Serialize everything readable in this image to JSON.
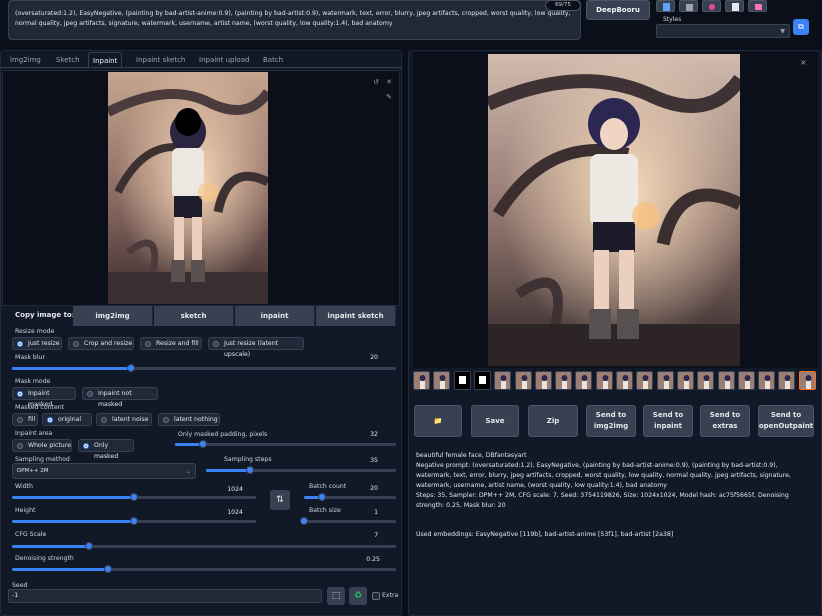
{
  "prompt_box": {
    "text": "(oversaturated:1.2), EasyNegative, (painting by bad-artist-anime:0.9), (painting by bad-artist:0.9), watermark, text, error, blurry, jpeg artifacts, cropped, worst quality, low quality, normal quality, jpeg artifacts, signature, watermark, username, artist name, (worst quality, low quality:1.4), bad anatomy",
    "token_counter": "69/75"
  },
  "toolbar": {
    "deepbooru_label": "DeepBooru",
    "styles_label": "Styles"
  },
  "tabs": [
    "img2img",
    "Sketch",
    "Inpaint",
    "Inpaint sketch",
    "Inpaint upload",
    "Batch"
  ],
  "copy_image": {
    "label": "Copy image to:",
    "targets": [
      "img2img",
      "sketch",
      "inpaint",
      "inpaint sketch"
    ]
  },
  "resize_mode": {
    "label": "Resize mode",
    "options": [
      "Just resize",
      "Crop and resize",
      "Resize and fill",
      "Just resize (latent upscale)"
    ],
    "selected": "Just resize"
  },
  "mask_blur": {
    "label": "Mask blur",
    "value": "20",
    "fraction": 0.31
  },
  "mask_mode": {
    "label": "Mask mode",
    "options": [
      "Inpaint masked",
      "Inpaint not masked"
    ],
    "selected": "Inpaint masked"
  },
  "masked_content": {
    "label": "Masked content",
    "options": [
      "fill",
      "original",
      "latent noise",
      "latent nothing"
    ],
    "selected": "original"
  },
  "inpaint_area": {
    "label": "Inpaint area",
    "options": [
      "Whole picture",
      "Only masked"
    ],
    "selected": "Only masked"
  },
  "only_masked_padding": {
    "label": "Only masked padding, pixels",
    "value": "32",
    "fraction": 0.125
  },
  "sampling_method": {
    "label": "Sampling method",
    "value": "DPM++ 2M"
  },
  "sampling_steps": {
    "label": "Sampling steps",
    "value": "35",
    "fraction": 0.23
  },
  "width": {
    "label": "Width",
    "value": "1024",
    "fraction": 0.5
  },
  "height": {
    "label": "Height",
    "value": "1024",
    "fraction": 0.5
  },
  "swap_icon": "⇅",
  "batch_count": {
    "label": "Batch count",
    "value": "20",
    "fraction": 0.2
  },
  "batch_size": {
    "label": "Batch size",
    "value": "1",
    "fraction": 0.0
  },
  "cfg_scale": {
    "label": "CFG Scale",
    "value": "7",
    "fraction": 0.2
  },
  "denoising_strength": {
    "label": "Denoising strength",
    "value": "0.25",
    "fraction": 0.25
  },
  "seed": {
    "label": "Seed",
    "value": "-1",
    "extra_label": "Extra"
  },
  "gallery": {
    "close_icon": "×",
    "thumbnail_count": 20
  },
  "actions": [
    {
      "name": "open-folder-button",
      "label": "📁"
    },
    {
      "name": "save-button",
      "label": "Save"
    },
    {
      "name": "zip-button",
      "label": "Zip"
    },
    {
      "name": "send-to-img2img-button",
      "label": "Send to img2img"
    },
    {
      "name": "send-to-inpaint-button",
      "label": "Send to inpaint"
    },
    {
      "name": "send-to-extras-button",
      "label": "Send to extras"
    },
    {
      "name": "send-to-openoutpaint-button",
      "label": "Send to openOutpaint"
    }
  ],
  "generation_info": {
    "prompt": "beautiful female face, DBfantasyart",
    "negative": "Negative prompt: (oversaturated:1.2), EasyNegative, (painting by bad-artist-anime:0.9), (painting by bad-artist:0.9), watermark, text, error, blurry, jpeg artifacts, cropped, worst quality, low quality, normal quality, jpeg artifacts, signature, watermark, username, artist name, (worst quality, low quality:1.4), bad anatomy",
    "params": "Steps: 35, Sampler: DPM++ 2M, CFG scale: 7, Seed: 3754119826, Size: 1024x1024, Model hash: ac75f5665f, Denoising strength: 0.25, Mask blur: 20",
    "embeddings": "Used embeddings: EasyNegative [119b], bad-artist-anime [53f1], bad-artist [2a38]"
  },
  "colors": {
    "accent": "#3b82f6",
    "background": "#0b0f19",
    "panel": "#111827",
    "button": "#374151"
  }
}
